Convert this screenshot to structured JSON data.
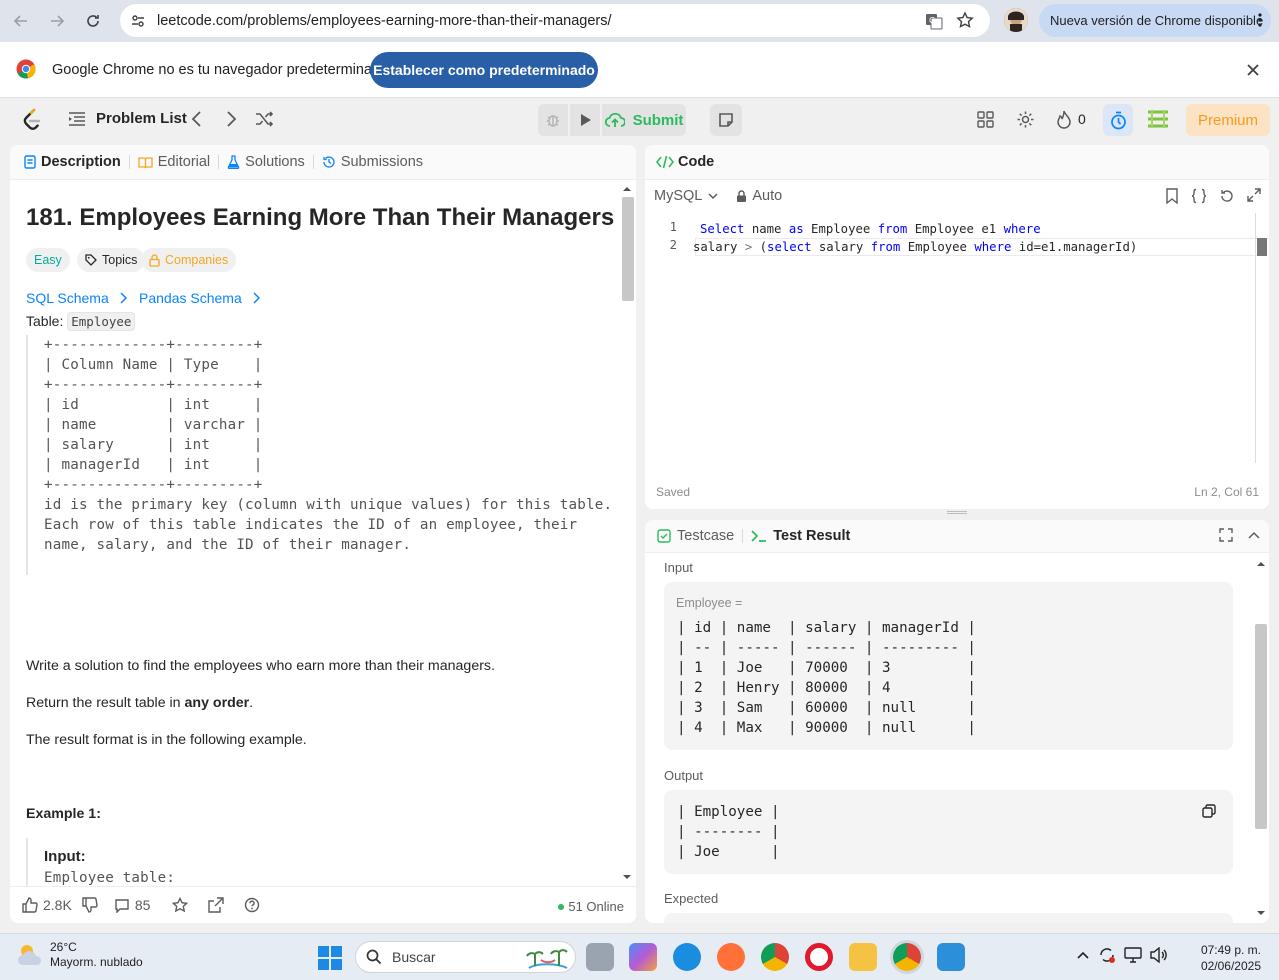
{
  "browser": {
    "url": "leetcode.com/problems/employees-earning-more-than-their-managers/",
    "update_label": "Nueva versión de Chrome disponible"
  },
  "default_banner": {
    "message": "Google Chrome no es tu navegador predeterminado",
    "button_label": "Establecer como predeterminado"
  },
  "header": {
    "problem_list_label": "Problem List",
    "submit_label": "Submit",
    "streak_count": "0",
    "premium_label": "Premium",
    "accent_color": "#2cbb5d",
    "premium_color": "#f59c1d"
  },
  "left_tabs": [
    "Description",
    "Editorial",
    "Solutions",
    "Submissions"
  ],
  "problem": {
    "title": "181. Employees Earning More Than Their Managers",
    "difficulty": "Easy",
    "topics_label": "Topics",
    "companies_label": "Companies",
    "sql_schema_label": "SQL Schema",
    "pandas_schema_label": "Pandas Schema",
    "table_prefix": "Table: ",
    "table_name": "Employee",
    "schema_text": "+-------------+---------+\n| Column Name | Type    |\n+-------------+---------+\n| id          | int     |\n| name        | varchar |\n| salary      | int     |\n| managerId   | int     |\n+-------------+---------+\nid is the primary key (column with unique values) for this table.\nEach row of this table indicates the ID of an employee, their\nname, salary, and the ID of their manager.",
    "task_text": "Write a solution to find the employees who earn more than their managers.",
    "return_prefix": "Return the result table in ",
    "return_bold": "any order",
    "return_suffix": ".",
    "format_text": "The result format is in the following example.",
    "example_heading": "Example 1:",
    "example_input_label": "Input:",
    "example_text": "Employee table:\n+----+-------+--------+-----------+\n| id | name  | salary | managerId |"
  },
  "left_footer": {
    "likes": "2.8K",
    "comments": "85",
    "online": "51 Online"
  },
  "code_panel": {
    "tab_label": "Code",
    "language": "MySQL",
    "mode": "Auto",
    "lines": [
      {
        "num": "1",
        "tokens": [
          [
            "kw",
            "Select"
          ],
          [
            "t",
            " name "
          ],
          [
            "kw",
            "as"
          ],
          [
            "t",
            " Employee "
          ],
          [
            "kw",
            "from"
          ],
          [
            "t",
            " Employee e1 "
          ],
          [
            "kw",
            "where"
          ]
        ]
      },
      {
        "num": "2",
        "tokens": [
          [
            "t",
            "salary "
          ],
          [
            "op",
            ">"
          ],
          [
            "t",
            " ("
          ],
          [
            "kw",
            "select"
          ],
          [
            "t",
            " salary "
          ],
          [
            "kw",
            "from"
          ],
          [
            "t",
            " Employee "
          ],
          [
            "kw",
            "where"
          ],
          [
            "t",
            " id=e1.managerId)"
          ]
        ]
      }
    ],
    "status": "Saved",
    "cursor_position": "Ln 2, Col 61"
  },
  "result_panel": {
    "tabs": [
      "Testcase",
      "Test Result"
    ],
    "input_label": "Input",
    "input_var": "Employee =",
    "input_table": "| id | name  | salary | managerId |\n| -- | ----- | ------ | --------- |\n| 1  | Joe   | 70000  | 3         |\n| 2  | Henry | 80000  | 4         |\n| 3  | Sam   | 60000  | null      |\n| 4  | Max   | 90000  | null      |",
    "output_label": "Output",
    "output_table": "| Employee |\n| -------- |\n| Joe      |",
    "expected_label": "Expected"
  },
  "taskbar": {
    "temperature": "26°C",
    "weather": "Mayorm. nublado",
    "search_placeholder": "Buscar",
    "time": "07:49 p. m.",
    "date": "02/06/2025"
  }
}
